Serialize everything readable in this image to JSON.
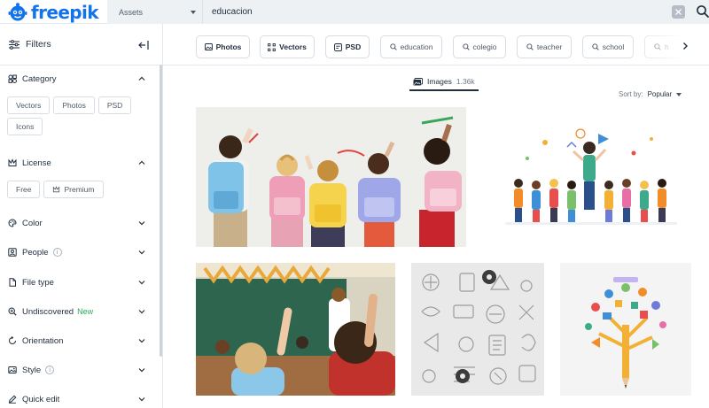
{
  "brand": {
    "name": "freepik",
    "color": "#1273eb"
  },
  "search": {
    "asset_type": "Assets",
    "query": "educacion",
    "placeholder": ""
  },
  "sidebar": {
    "title": "Filters",
    "sections": [
      {
        "id": "category",
        "label": "Category",
        "icon": "category-icon",
        "expanded": true,
        "options": [
          "Vectors",
          "Photos",
          "PSD",
          "Icons"
        ]
      },
      {
        "id": "license",
        "label": "License",
        "icon": "crown-icon",
        "expanded": true,
        "options": [
          "Free",
          "Premium"
        ]
      },
      {
        "id": "color",
        "label": "Color",
        "icon": "palette-icon",
        "expanded": false
      },
      {
        "id": "people",
        "label": "People",
        "icon": "person-icon",
        "expanded": false,
        "info": true
      },
      {
        "id": "file_type",
        "label": "File type",
        "icon": "file-icon",
        "expanded": false
      },
      {
        "id": "undiscovered",
        "label": "Undiscovered",
        "extra": "New",
        "icon": "discover-icon",
        "expanded": false
      },
      {
        "id": "orientation",
        "label": "Orientation",
        "icon": "orientation-icon",
        "expanded": false
      },
      {
        "id": "style",
        "label": "Style",
        "icon": "style-icon",
        "expanded": false,
        "info": true
      },
      {
        "id": "quick_edit",
        "label": "Quick edit",
        "icon": "quick-edit-icon",
        "expanded": false
      }
    ]
  },
  "tags": [
    {
      "label": "Photos",
      "icon": "photo-icon",
      "bold": true
    },
    {
      "label": "Vectors",
      "icon": "vector-icon",
      "bold": true
    },
    {
      "label": "PSD",
      "icon": "psd-icon",
      "bold": true
    },
    {
      "label": "education",
      "icon": "search-icon",
      "bold": false
    },
    {
      "label": "colegio",
      "icon": "search-icon",
      "bold": false
    },
    {
      "label": "teacher",
      "icon": "search-icon",
      "bold": false
    },
    {
      "label": "school",
      "icon": "search-icon",
      "bold": false
    },
    {
      "label": "h",
      "icon": "search-icon",
      "bold": false
    }
  ],
  "results_tab": {
    "label": "Images",
    "count": "1.36k"
  },
  "sort": {
    "label": "Sort by:",
    "value": "Popular"
  },
  "info_mark": "i",
  "colors": {
    "accent": "#1273eb",
    "new_badge": "#27ae60",
    "text": "#1f2d3d",
    "muted": "#6c7886"
  }
}
